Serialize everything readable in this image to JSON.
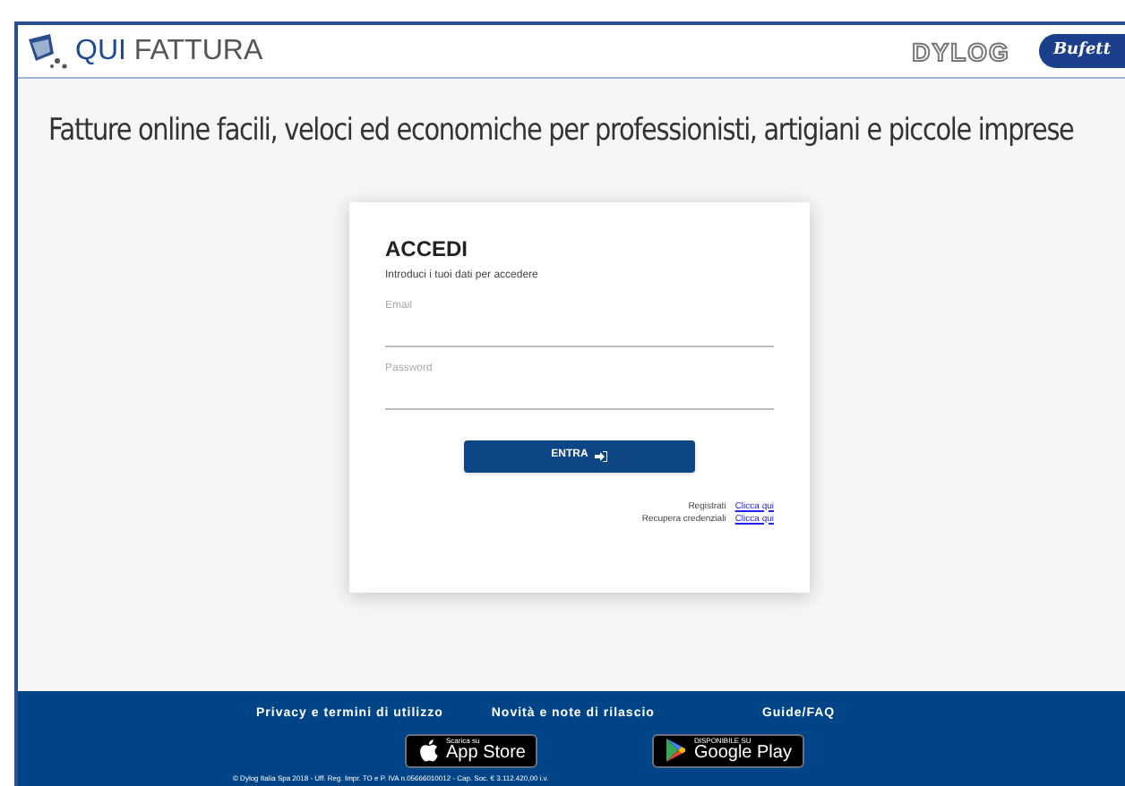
{
  "header": {
    "brand_primary": "QUI",
    "brand_secondary": "FATTURA",
    "partner_logos": [
      {
        "text": "DYLOG",
        "kind": "outline"
      },
      {
        "text": "Bufett",
        "kind": "oval"
      }
    ]
  },
  "headline": "Fatture online facili, veloci ed economiche per professionisti, artigiani e piccole imprese",
  "login": {
    "title": "ACCEDI",
    "subtitle": "Introduci i tuoi dati per accedere",
    "fields": [
      {
        "placeholder": "Email"
      },
      {
        "placeholder": "Password"
      }
    ],
    "button": "ENTRA",
    "links": [
      {
        "label": "Registrati",
        "link": "Clicca qui"
      },
      {
        "label": "Recupera credenziali",
        "link": "Clicca qui"
      }
    ]
  },
  "footer": {
    "links": [
      "Privacy e termini di utilizzo",
      "Novità e note di rilascio",
      "Guide/FAQ"
    ],
    "badges": [
      {
        "kind": "apple",
        "small": "Scarica su",
        "big": "App Store"
      },
      {
        "kind": "google",
        "small": "DISPONIBILE SU",
        "big": "Google Play"
      }
    ],
    "copyright": "© Dylog Italia Spa 2018 - Uff. Reg. Impr. TO e P. IVA n.05666010012 - Cap. Soc. € 3.112.420,00 i.v."
  }
}
